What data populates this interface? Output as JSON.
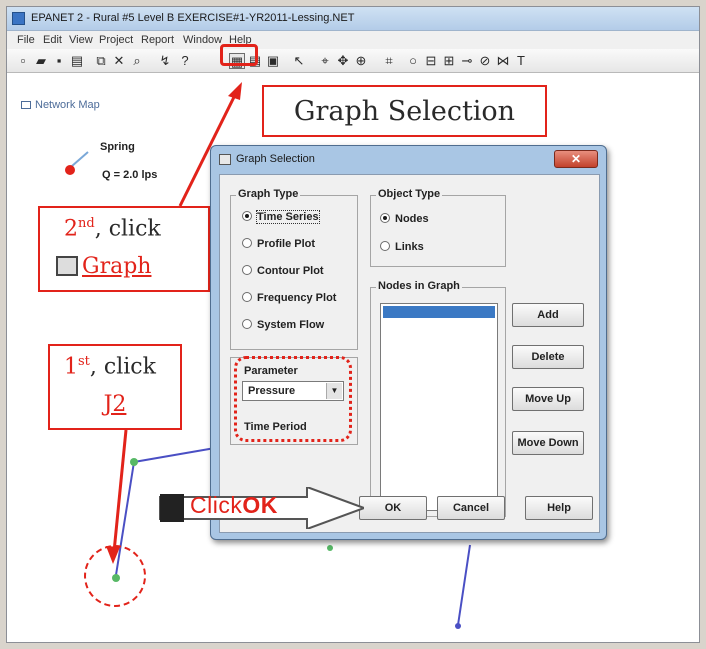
{
  "window": {
    "title": "EPANET 2 - Rural #5 Level B EXERCISE#1-YR2011-Lessing.NET",
    "menu": [
      "File",
      "Edit",
      "View",
      "Project",
      "Report",
      "Window",
      "Help"
    ]
  },
  "map": {
    "panel_label": "Network Map",
    "reservoir_label": "Spring",
    "flow_label": "Q = 2.0 lps"
  },
  "callouts": {
    "graph_selection": "Graph Selection",
    "step2_ordinal": "2",
    "step2_sup": "nd",
    "step2_text": ", click",
    "step2_link": "Graph",
    "step1_ordinal": "1",
    "step1_sup": "st",
    "step1_text": ", click",
    "step1_link": "J2",
    "click_prefix": "Click",
    "click_ok": "OK"
  },
  "dialog": {
    "title": "Graph Selection",
    "close_glyph": "✕",
    "graph_type_label": "Graph Type",
    "graph_types": [
      "Time Series",
      "Profile Plot",
      "Contour Plot",
      "Frequency Plot",
      "System Flow"
    ],
    "selected_graph_type": "Time Series",
    "object_type_label": "Object Type",
    "object_types": [
      "Nodes",
      "Links"
    ],
    "selected_object_type": "Nodes",
    "parameter_label": "Parameter",
    "parameter_value": "Pressure",
    "time_period_label": "Time Period",
    "nodes_in_graph_label": "Nodes in Graph",
    "buttons": {
      "add": "Add",
      "delete": "Delete",
      "move_up": "Move Up",
      "move_down": "Move Down",
      "ok": "OK",
      "cancel": "Cancel",
      "help": "Help"
    }
  },
  "colors": {
    "annotation_red": "#e2231a",
    "node_green": "#57b866",
    "pipe_blue": "#4a4fc4",
    "dialog_frame": "#a9c6e4"
  }
}
